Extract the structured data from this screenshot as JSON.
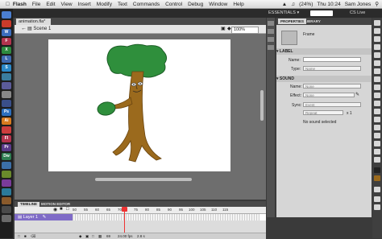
{
  "menu_bar": {
    "app_name": "Flash",
    "items": [
      "File",
      "Edit",
      "View",
      "Insert",
      "Modify",
      "Text",
      "Commands",
      "Control",
      "Debug",
      "Window",
      "Help"
    ],
    "battery": "(24%)",
    "clock": "Thu 10:24",
    "user": "Sam Jones"
  },
  "app_bar": {
    "workspace": "ESSENTIALS ▾",
    "cs_live": "CS Live"
  },
  "document": {
    "tab_label": "animation.fla*",
    "scene_label": "Scene 1",
    "zoom": "100%"
  },
  "properties": {
    "tabs": [
      "PROPERTIES",
      "LIBRARY"
    ],
    "symbol_type": "Frame",
    "label_section": "LABEL",
    "name_label": "Name:",
    "type_label": "Type:",
    "type_value": "Name",
    "sound_section": "SOUND",
    "sound_name_label": "Name:",
    "sound_name_value": "None",
    "effect_label": "Effect:",
    "effect_value": "None",
    "sync_label": "Sync:",
    "sync_value": "Event",
    "repeat_value": "Repeat",
    "repeat_count": "x 1",
    "no_sound": "No sound selected"
  },
  "timeline": {
    "tabs": [
      "TIMELINE",
      "MOTION EDITOR"
    ],
    "layer_name": "Layer 1",
    "ruler_ticks": [
      "50",
      "55",
      "60",
      "65",
      "70",
      "75",
      "80",
      "85",
      "90",
      "95",
      "100",
      "105",
      "110",
      "115"
    ],
    "current_frame": "69",
    "fps": "24.00 fps",
    "elapsed": "2.8 s"
  },
  "colors": {
    "layer_highlight": "#7f6bc7",
    "playhead": "#e33333",
    "tree_trunk": "#9b6a1d",
    "tree_leaves": "#2f8f3c"
  }
}
